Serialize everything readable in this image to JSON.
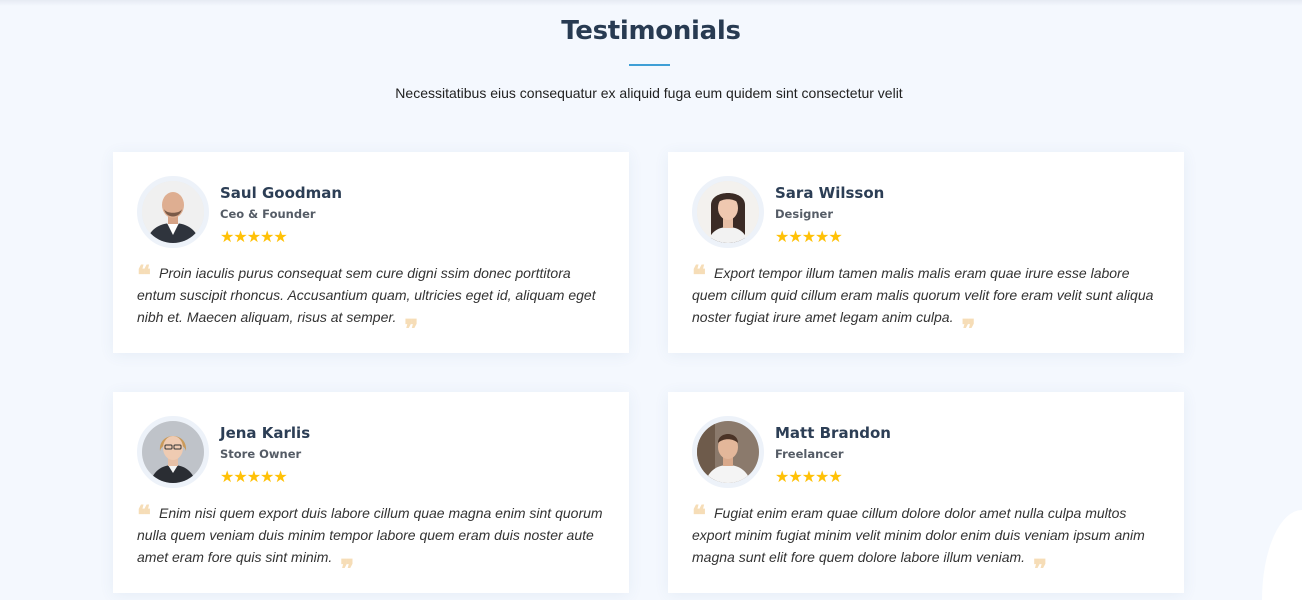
{
  "section": {
    "title": "Testimonials",
    "subtitle": "Necessitatibus eius consequatur ex aliquid fuga eum quidem sint consectetur velit"
  },
  "testimonials": [
    {
      "name": "Saul Goodman",
      "role": "Ceo & Founder",
      "rating": 5,
      "stars": "★★★★★",
      "quote": "Proin iaculis purus consequat sem cure digni ssim donec porttitora entum suscipit rhoncus. Accusantium quam, ultricies eget id, aliquam eget nibh et. Maecen aliquam, risus at semper."
    },
    {
      "name": "Sara Wilsson",
      "role": "Designer",
      "rating": 5,
      "stars": "★★★★★",
      "quote": "Export tempor illum tamen malis malis eram quae irure esse labore quem cillum quid cillum eram malis quorum velit fore eram velit sunt aliqua noster fugiat irure amet legam anim culpa."
    },
    {
      "name": "Jena Karlis",
      "role": "Store Owner",
      "rating": 5,
      "stars": "★★★★★",
      "quote": "Enim nisi quem export duis labore cillum quae magna enim sint quorum nulla quem veniam duis minim tempor labore quem eram duis noster aute amet eram fore quis sint minim."
    },
    {
      "name": "Matt Brandon",
      "role": "Freelancer",
      "rating": 5,
      "stars": "★★★★★",
      "quote": "Fugiat enim eram quae cillum dolore dolor amet nulla culpa multos export minim fugiat minim velit minim dolor enim duis veniam ipsum anim magna sunt elit fore quem dolore labore illum veniam."
    }
  ],
  "icons": {
    "quote_open": "quote-left-icon",
    "quote_close": "quote-right-icon",
    "star": "star-icon"
  },
  "colors": {
    "background": "#f4f8fe",
    "title": "#283b52",
    "accent": "#3f9fd6",
    "star": "#ffc107",
    "quote_mark": "#f6ddb7"
  }
}
